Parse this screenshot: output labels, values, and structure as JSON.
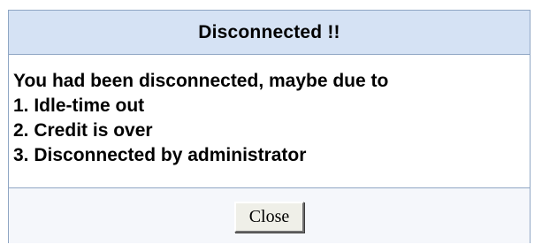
{
  "dialog": {
    "title": "Disconnected !!",
    "message_lines": [
      "You had been disconnected, maybe due to",
      "1. Idle-time out",
      "2. Credit is over",
      "3. Disconnected by administrator"
    ],
    "close_label": "Close"
  },
  "colors": {
    "header_background": "#d5e2f4",
    "border": "#8fa6c4",
    "footer_background": "#f5f7fb",
    "button_face": "#efefe8"
  }
}
